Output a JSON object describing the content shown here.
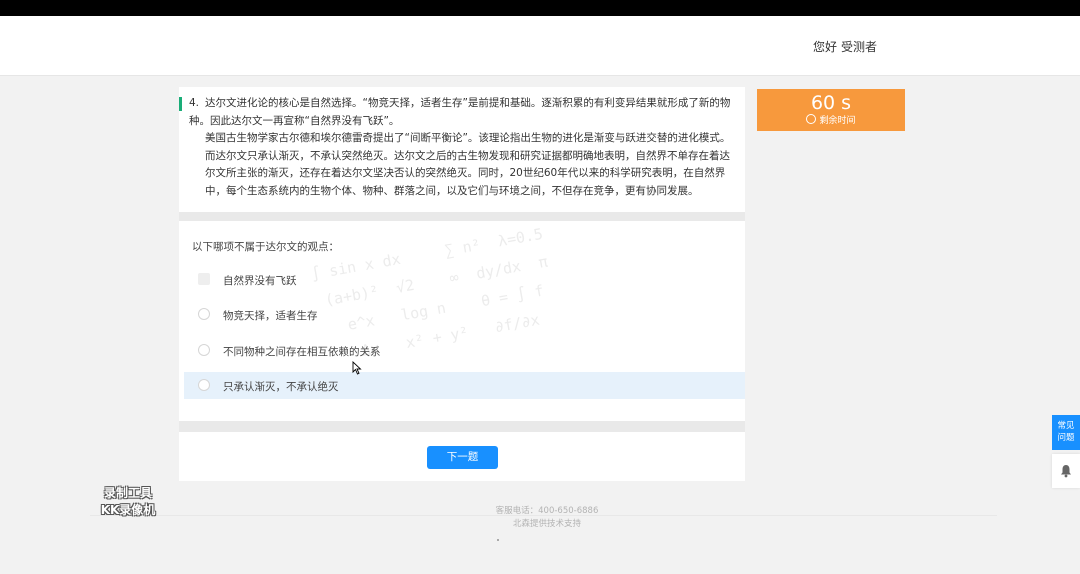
{
  "header": {
    "greeting": "您好",
    "user_name": "受测者"
  },
  "question": {
    "number": "4.",
    "passage": [
      "达尔文进化论的核心是自然选择。“物竞天择，适者生存”是前提和基础。逐渐积累的有利变异结果就形成了新的物种。因此达尔文一再宣称“自然界没有飞跃”。",
      "美国古生物学家古尔德和埃尔德雷奇提出了“间断平衡论”。该理论指出生物的进化是渐变与跃进交替的进化模式。而达尔文只承认渐灭，不承认突然绝灭。达尔文之后的古生物发现和研究证据都明确地表明，自然界不单存在着达尔文所主张的渐灭，还存在着达尔文坚决否认的突然绝灭。同时，20世纪60年代以来的科学研究表明，在自然界中，每个生态系统内的生物个体、物种、群落之间，以及它们与环境之间，不但存在竞争，更有协同发展。"
    ],
    "prompt": "以下哪项不属于达尔文的观点：",
    "options": [
      {
        "label": "自然界没有飞跃"
      },
      {
        "label": "物竞天择，适者生存"
      },
      {
        "label": "不同物种之间存在相互依赖的关系"
      },
      {
        "label": "只承认渐灭，不承认绝灭"
      }
    ],
    "selected_index": 3
  },
  "navigation": {
    "next_label": "下一题"
  },
  "timer": {
    "value": "60 s",
    "label": "剩余时间",
    "color": "#f7993d"
  },
  "footer": {
    "phone": "客服电话：400-650-6886",
    "support": "北森提供技术支持"
  },
  "recorder_watermark": {
    "line1": "录制工具",
    "line2": "KK录像机"
  },
  "side_tools": {
    "faq_line1": "常见",
    "faq_line2": "问题",
    "bell_icon": "bell-icon"
  },
  "colors": {
    "accent": "#1890ff",
    "timer": "#f7993d",
    "selected_row": "#e6f1fb"
  }
}
